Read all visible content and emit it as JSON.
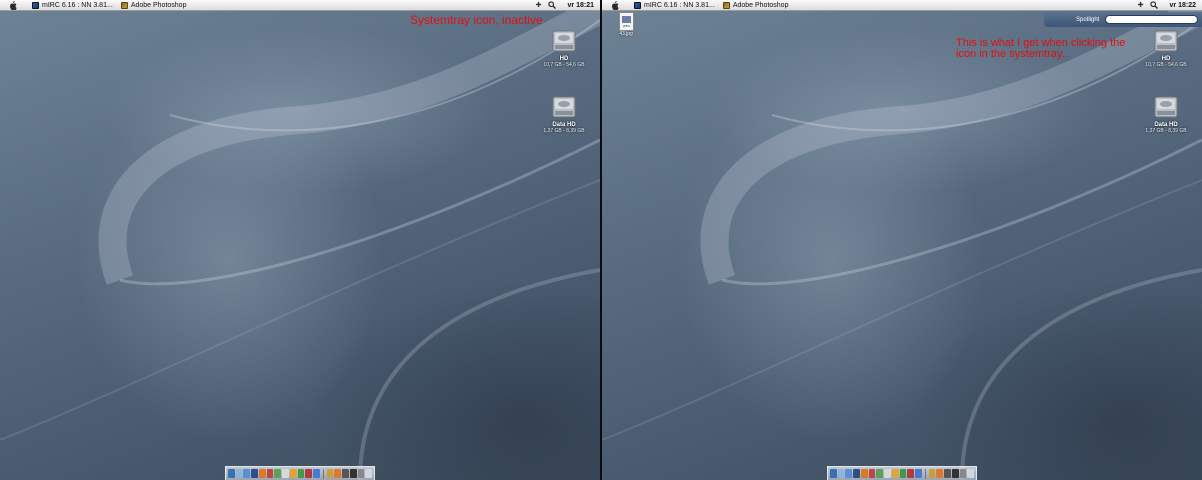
{
  "screens": [
    {
      "menubar": {
        "apps": [
          {
            "label": "mIRC 6.16 : NN 3.81...",
            "icon": "mirc-icon"
          },
          {
            "label": "Adobe Photoshop",
            "icon": "photoshop-icon"
          }
        ],
        "clock": "vr 18:21"
      },
      "disks": [
        {
          "name": "HD",
          "info": "10,7 GB - 54,6 GB"
        },
        {
          "name": "Data HD",
          "info": "1,37 GB - 8,39 GB"
        }
      ],
      "annotation": "Systemtray icon, inactive"
    },
    {
      "menubar": {
        "apps": [
          {
            "label": "mIRC 6.16 : NN 3.81...",
            "icon": "mirc-icon"
          },
          {
            "label": "Adobe Photoshop",
            "icon": "photoshop-icon"
          }
        ],
        "clock": "vr 18:22"
      },
      "spotlight": {
        "label": "Spotlight"
      },
      "file": {
        "label": "43.jpg"
      },
      "disks": [
        {
          "name": "HD",
          "info": "10,7 GB - 54,6 GB"
        },
        {
          "name": "Data HD",
          "info": "1,37 GB - 8,39 GB"
        }
      ],
      "annotation": "This is what I get when clicking the icon in the systemtray.."
    }
  ],
  "colors": {
    "annotation": "#e01010",
    "menubar": "#e8e8e8",
    "spotlight": "#4a6485"
  }
}
